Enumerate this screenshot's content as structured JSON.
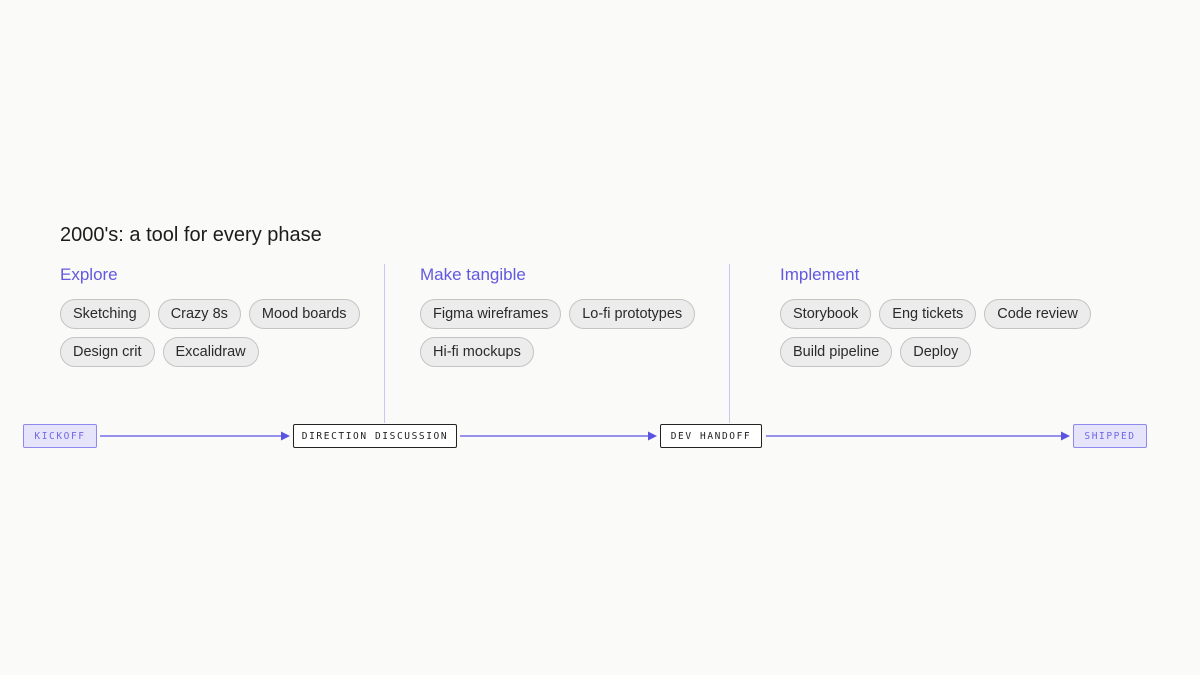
{
  "title": "2000's: a tool for every phase",
  "phases": [
    {
      "title": "Explore",
      "tools": [
        "Sketching",
        "Crazy 8s",
        "Mood boards",
        "Design crit",
        "Excalidraw"
      ]
    },
    {
      "title": "Make tangible",
      "tools": [
        "Figma wireframes",
        "Lo-fi prototypes",
        "Hi-fi mockups"
      ]
    },
    {
      "title": "Implement",
      "tools": [
        "Storybook",
        "Eng tickets",
        "Code review",
        "Build pipeline",
        "Deploy"
      ]
    }
  ],
  "milestones": {
    "start": "KICKOFF",
    "gate_1": "DIRECTION DISCUSSION",
    "gate_2": "DEV HANDOFF",
    "end": "SHIPPED"
  },
  "colors": {
    "accent": "#6159e0",
    "arrow": "#5b54e0",
    "endpoint_fill": "#e6e4fb",
    "chip_fill": "#ececec",
    "divider": "#c9c7f2"
  }
}
